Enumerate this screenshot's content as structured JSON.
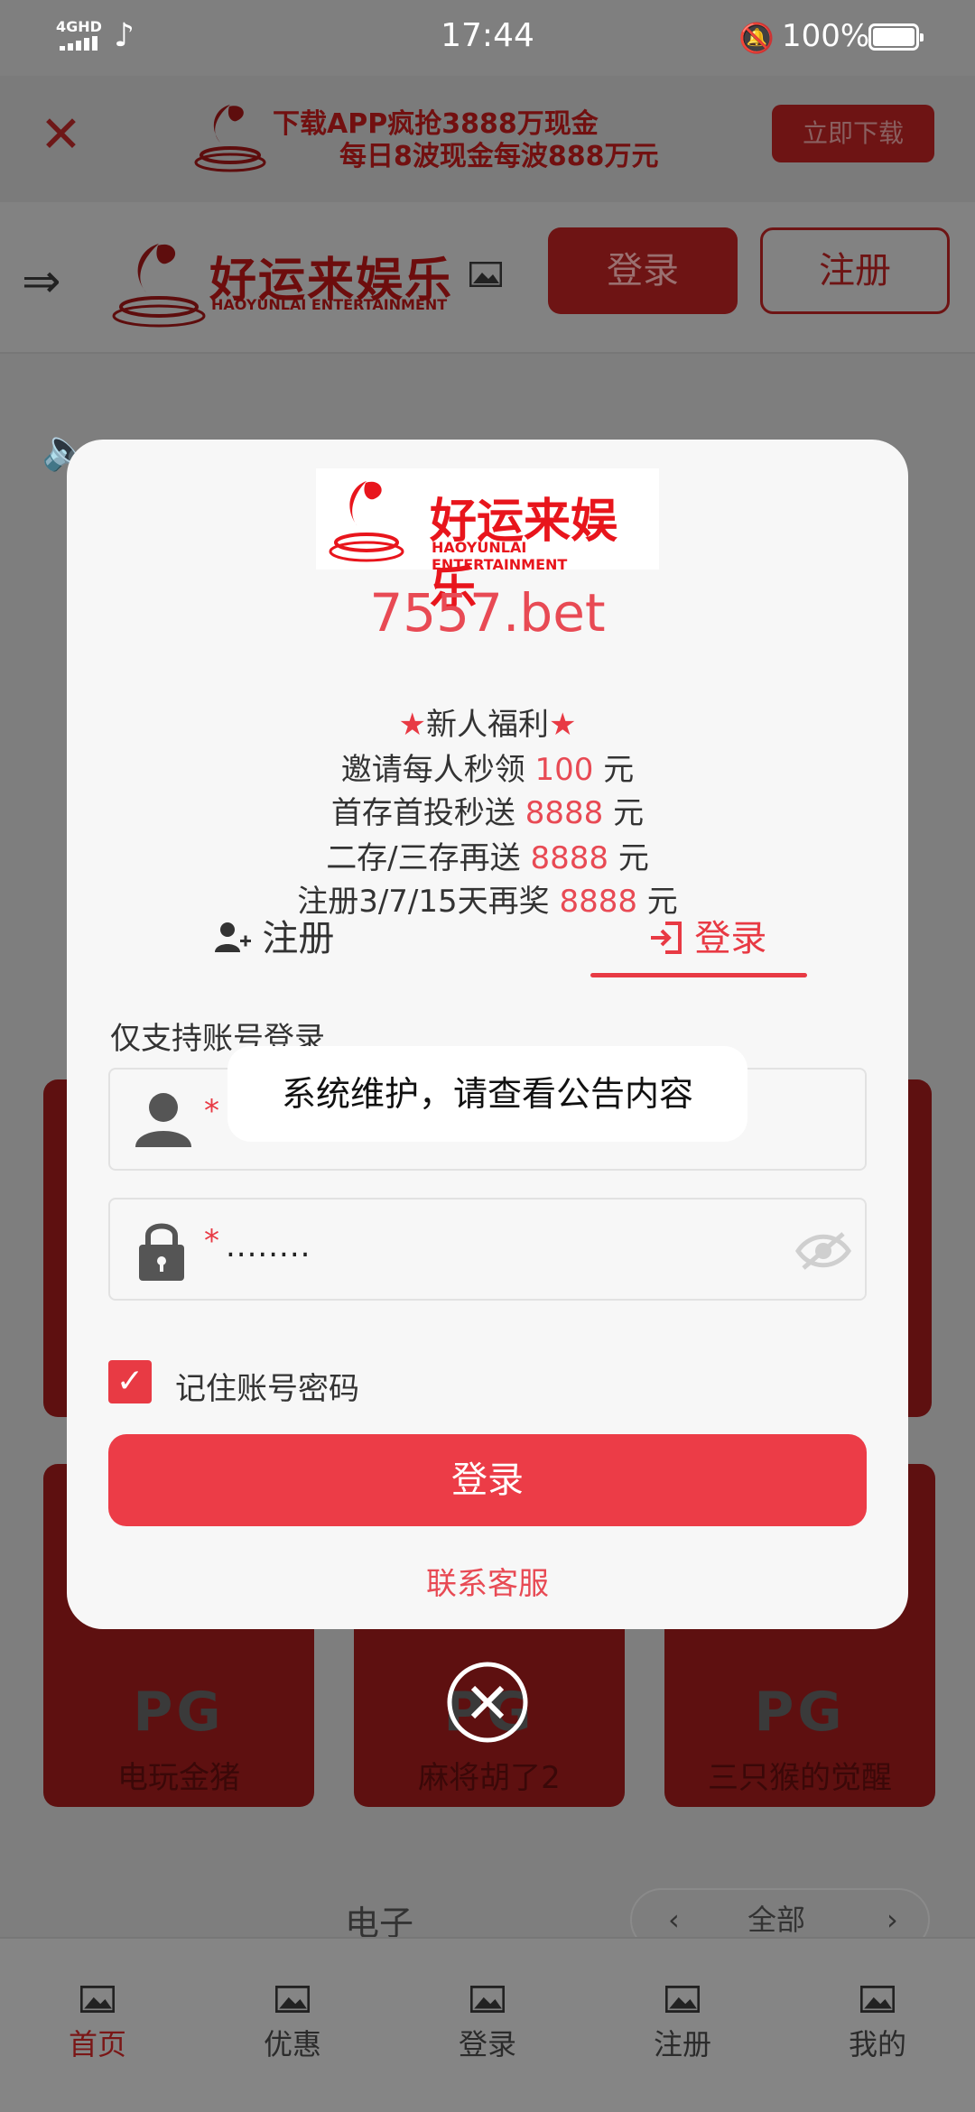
{
  "status_bar": {
    "network": "4GHD",
    "time": "17:44",
    "battery": "100%"
  },
  "download_banner": {
    "line1": "下载APP疯抢3888万现金",
    "line2": "每日8波现金每波888万元",
    "button": "立即下载"
  },
  "top_nav": {
    "logo_cn": "好运来娱乐",
    "logo_en": "HAOYUNLAI ENTERTAINMENT",
    "login": "登录",
    "register": "注册"
  },
  "background": {
    "cards": [
      {
        "badge": "PG",
        "name": "电玩金猪"
      },
      {
        "badge": "PG",
        "name": "麻将胡了2"
      },
      {
        "badge": "PG",
        "name": "三只猴的觉醒"
      }
    ],
    "section_title": "电子",
    "pager": {
      "prev": "‹",
      "label": "全部",
      "next": "›"
    }
  },
  "tabbar": [
    {
      "label": "首页",
      "active": true
    },
    {
      "label": "优惠",
      "active": false
    },
    {
      "label": "登录",
      "active": false
    },
    {
      "label": "注册",
      "active": false
    },
    {
      "label": "我的",
      "active": false
    }
  ],
  "modal": {
    "logo_cn": "好运来娱乐",
    "logo_en": "HAOYUNLAI ENTERTAINMENT",
    "domain": "7557.bet",
    "promo_title": "新人福利",
    "promos": [
      {
        "text": "邀请每人秒领",
        "amount": "100",
        "unit": "元"
      },
      {
        "text": "首存首投秒送",
        "amount": "8888",
        "unit": "元"
      },
      {
        "text": "二存/三存再送",
        "amount": "8888",
        "unit": "元"
      },
      {
        "text": "注册3/7/15天再奖",
        "amount": "8888",
        "unit": "元"
      }
    ],
    "tab_register": "注册",
    "tab_login": "登录",
    "note": "仅支持账号登录",
    "password_value": "........",
    "toast": "系统维护，请查看公告内容",
    "remember_label": "记住账号密码",
    "submit": "登录",
    "support": "联系客服"
  },
  "colors": {
    "accent": "#e83a44",
    "brand_dark": "#6e1414"
  }
}
